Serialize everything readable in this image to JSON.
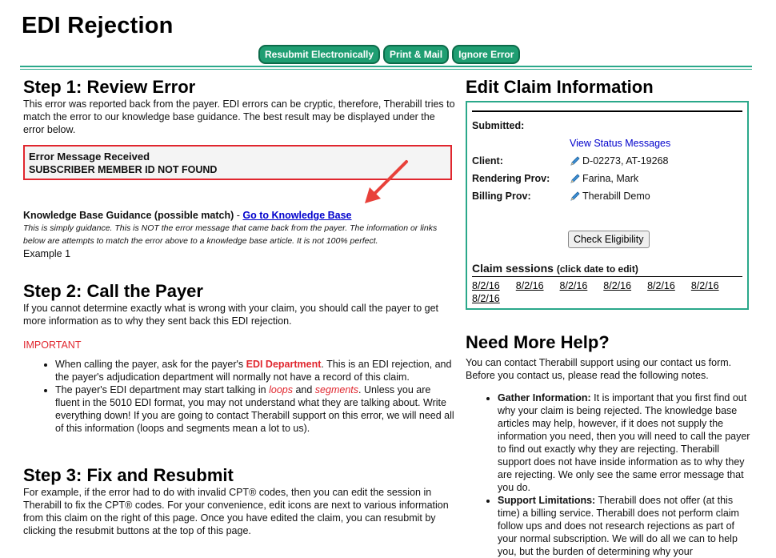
{
  "page": {
    "title": "EDI Rejection"
  },
  "toolbar": {
    "resubmit_label": "Resubmit Electronically",
    "print_label": "Print & Mail",
    "ignore_label": "Ignore Error"
  },
  "step1": {
    "heading": "Step 1: Review Error",
    "intro": "This error was reported back from the payer. EDI errors can be cryptic, therefore, Therabill tries to match the error to our knowledge base guidance. The best result may be displayed under the error below.",
    "error_title": "Error Message Received",
    "error_message": "SUBSCRIBER MEMBER ID NOT FOUND",
    "kb_label": "Knowledge Base Guidance (possible match)",
    "kb_separator": " - ",
    "kb_link": "Go to Knowledge Base",
    "kb_disclaimer": "This is simply guidance. This is NOT the error message that came back from the payer. The information or links below are attempts to match the error above to a knowledge base article. It is not 100% perfect.",
    "kb_example": "Example 1"
  },
  "step2": {
    "heading": "Step 2: Call the Payer",
    "intro": "If you cannot determine exactly what is wrong with your claim, you should call the payer to get more information as to why they sent back this EDI rejection.",
    "important": "IMPORTANT",
    "bullet1_pre": "When calling the payer, ask for the payer's ",
    "bullet1_highlight": "EDI Department",
    "bullet1_post": ". This is an EDI rejection, and the payer's adjudication department will normally not have a record of this claim.",
    "bullet2_pre": "The payer's EDI department may start talking in ",
    "bullet2_loops": "loops",
    "bullet2_and": " and ",
    "bullet2_segments": "segments",
    "bullet2_post": ". Unless you are fluent in the 5010 EDI format, you may not understand what they are talking about. Write everything down! If you are going to contact Therabill support on this error, we will need all of this information (loops and segments mean a lot to us)."
  },
  "step3": {
    "heading": "Step 3: Fix and Resubmit",
    "intro": "For example, if the error had to do with invalid CPT® codes, then you can edit the session in Therabill to fix the CPT® codes. For your convenience, edit icons are next to various information from this claim on the right of this page. Once you have edited the claim, you can resubmit by clicking the resubmit buttons at the top of this page."
  },
  "edit_claim": {
    "heading": "Edit Claim Information",
    "submitted_label": "Submitted:",
    "view_status": "View Status Messages",
    "client_label": "Client:",
    "client_value": "D-02273, AT-19268",
    "rendering_label": "Rendering Prov:",
    "rendering_value": "Farina, Mark",
    "billing_label": "Billing Prov:",
    "billing_value": "Therabill Demo",
    "check_eligibility": "Check Eligibility",
    "sessions_label": "Claim sessions",
    "sessions_hint": "(click date to edit)",
    "session_dates": [
      "8/2/16",
      "8/2/16",
      "8/2/16",
      "8/2/16",
      "8/2/16",
      "8/2/16",
      "8/2/16"
    ]
  },
  "help": {
    "heading": "Need More Help?",
    "intro": "You can contact Therabill support using our contact us form. Before you contact us, please read the following notes.",
    "item1_title": "Gather Information:",
    "item1_text": " It is important that you first find out why your claim is being rejected. The knowledge base articles may help, however, if it does not supply the information you need, then you will need to call the payer to find out exactly why they are rejecting. Therabill support does not have inside information as to why they are rejecting. We only see the same error message that you do.",
    "item2_title": "Support Limitations:",
    "item2_text": " Therabill does not offer (at this time) a billing service. Therabill does not perform claim follow ups and does not research rejections as part of your normal subscription. We will do all we can to help you, but the burden of determining why your"
  },
  "colors": {
    "accent": "#1f9e72",
    "error": "#e0262e",
    "link": "#0000cc"
  },
  "icons": [
    "pencil-icon",
    "arrow-icon"
  ]
}
